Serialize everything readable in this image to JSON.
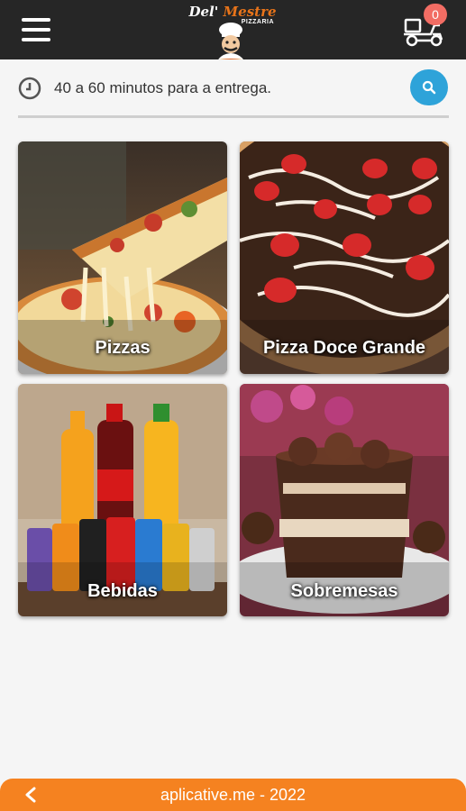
{
  "header": {
    "brand_title_part1": "Del' ",
    "brand_title_part2": "Mestre",
    "brand_subtitle": "PIZZARIA",
    "cart_count": "0",
    "menu_icon": "hamburger-menu-icon",
    "cart_icon": "delivery-scooter-icon"
  },
  "delivery": {
    "text": "40 a 60 minutos para a entrega.",
    "icon": "clock-icon",
    "search_icon": "search-icon"
  },
  "categories": [
    {
      "label": "Pizzas"
    },
    {
      "label": "Pizza Doce Grande"
    },
    {
      "label": "Bebidas"
    },
    {
      "label": "Sobremesas"
    }
  ],
  "footer": {
    "text": "aplicative.me - 2022",
    "back_icon": "chevron-left-icon"
  },
  "colors": {
    "topbar": "#262626",
    "footer": "#f58220",
    "search": "#2ea3d9",
    "badge": "#f26d64"
  }
}
